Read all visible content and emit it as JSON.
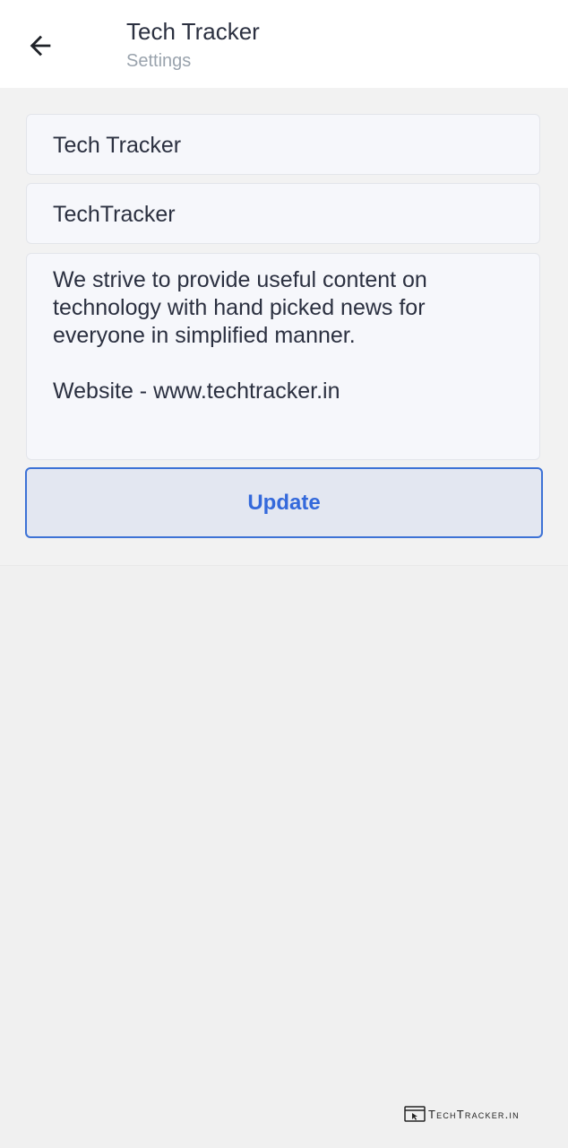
{
  "header": {
    "title": "Tech Tracker",
    "subtitle": "Settings",
    "back_icon": "arrow-left-icon"
  },
  "form": {
    "name_value": "Tech Tracker",
    "username_value": "TechTracker",
    "bio_value": "We strive to provide useful content on technology with hand picked news for everyone in simplified manner.\n\nWebsite - www.techtracker.in",
    "update_label": "Update"
  },
  "watermark": {
    "text": "TechTracker.in"
  },
  "colors": {
    "accent": "#3469db",
    "background": "#f0f0f0",
    "field_background": "#f6f7fb",
    "subtitle": "#9aa3ad"
  }
}
